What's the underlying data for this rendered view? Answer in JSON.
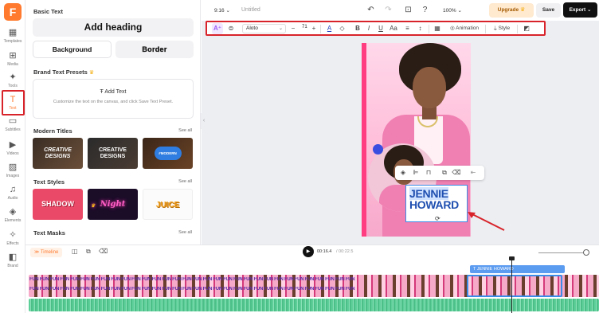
{
  "rail": {
    "items": [
      {
        "label": "Templates",
        "icon": "templates-icon",
        "glyph": "▦"
      },
      {
        "label": "Media",
        "icon": "media-icon",
        "glyph": "⊞"
      },
      {
        "label": "Tools",
        "icon": "tools-icon",
        "glyph": "✦"
      },
      {
        "label": "Text",
        "icon": "text-icon",
        "glyph": "T"
      },
      {
        "label": "Subtitles",
        "icon": "subtitles-icon",
        "glyph": "▭"
      },
      {
        "label": "Videos",
        "icon": "videos-icon",
        "glyph": "▶"
      },
      {
        "label": "Images",
        "icon": "images-icon",
        "glyph": "▨"
      },
      {
        "label": "Audio",
        "icon": "audio-icon",
        "glyph": "♫"
      },
      {
        "label": "Elements",
        "icon": "elements-icon",
        "glyph": "◈"
      },
      {
        "label": "Effects",
        "icon": "effects-icon",
        "glyph": "✧"
      },
      {
        "label": "Brand",
        "icon": "brand-icon",
        "glyph": "◧"
      }
    ]
  },
  "panel": {
    "basic_title": "Basic Text",
    "add_heading": "Add heading",
    "background": "Background",
    "border": "Border",
    "brand_presets_title": "Brand Text Presets",
    "add_text": "Add Text",
    "preset_hint": "Customize the text on the canvas, and click Save Text Preset.",
    "modern_titles": "Modern Titles",
    "text_styles": "Text Styles",
    "text_masks": "Text Masks",
    "see_all": "See all",
    "thumbs": {
      "creative1": "CREATIVE DESIGNS",
      "creative2": "CREATIVE DESIGNS",
      "modern": "#MODERN",
      "shadow": "SHADOW",
      "night": "Night",
      "juice": "JUICE"
    }
  },
  "topbar": {
    "ratio": "9:16",
    "title": "Untitled",
    "zoom": "100%",
    "upgrade": "Upgrade",
    "save": "Save",
    "export": "Export"
  },
  "toolbar": {
    "font": "Aloto",
    "font_size": "71",
    "animation": "Animation",
    "style": "Style"
  },
  "canvas": {
    "line1": "JENNIE",
    "line2": "HOWARD"
  },
  "timeline": {
    "label": "Timeline",
    "current": "00:16.4",
    "total": "/ 00:22.5",
    "text_clip": "JENNIE HOWARD",
    "clip_text": "FUN FUN FUN FUN FUN FUN FUN FUN FUN FUN FUN FUN FUN FUN FUN FUN FUN FUN FUN FUN FUN FUN FUN FUN FUN FUN FUN FUN FUN FUN FUN FUN"
  },
  "colors": {
    "accent": "#ff7a2f",
    "highlight": "#d8232a",
    "export_bg": "#111111",
    "text_blue": "#1f4fb0"
  }
}
